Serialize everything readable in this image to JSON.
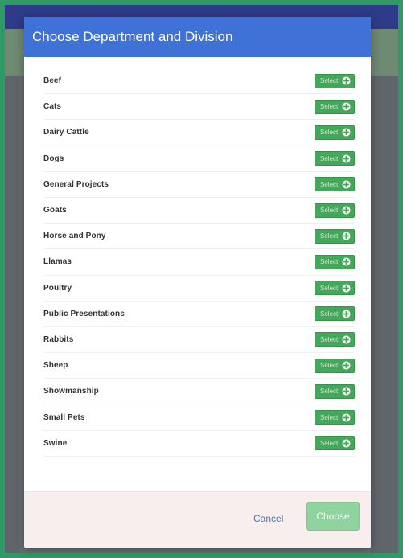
{
  "modal": {
    "title": "Choose Department and Division",
    "departments": [
      {
        "label": "Beef",
        "button_label": "Select"
      },
      {
        "label": "Cats",
        "button_label": "Select"
      },
      {
        "label": "Dairy Cattle",
        "button_label": "Select"
      },
      {
        "label": "Dogs",
        "button_label": "Select"
      },
      {
        "label": "General Projects",
        "button_label": "Select"
      },
      {
        "label": "Goats",
        "button_label": "Select"
      },
      {
        "label": "Horse and Pony",
        "button_label": "Select"
      },
      {
        "label": "Llamas",
        "button_label": "Select"
      },
      {
        "label": "Poultry",
        "button_label": "Select"
      },
      {
        "label": "Public Presentations",
        "button_label": "Select"
      },
      {
        "label": "Rabbits",
        "button_label": "Select"
      },
      {
        "label": "Sheep",
        "button_label": "Select"
      },
      {
        "label": "Showmanship",
        "button_label": "Select"
      },
      {
        "label": "Small Pets",
        "button_label": "Select"
      },
      {
        "label": "Swine",
        "button_label": "Select"
      }
    ],
    "footer": {
      "cancel_label": "Cancel",
      "choose_label": "Choose"
    }
  },
  "icons": {
    "select_icon": "plus-circle-icon"
  },
  "colors": {
    "header_bg": "#3f71d7",
    "select_button_bg": "#43a85a",
    "choose_button_bg": "#8fd39f",
    "cancel_link": "#4f71b0"
  }
}
